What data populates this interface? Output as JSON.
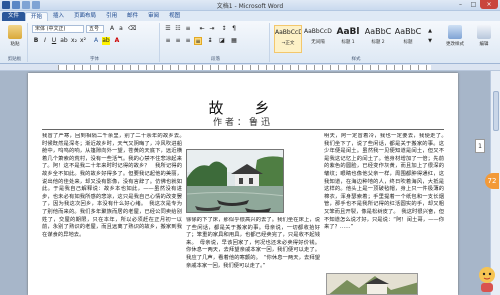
{
  "window": {
    "title": "文档1 - Microsoft Word",
    "minimize": "–",
    "maximize": "□",
    "close": "×"
  },
  "tabs": [
    "文件",
    "开始",
    "插入",
    "页面布局",
    "引用",
    "邮件",
    "审阅",
    "视图"
  ],
  "ribbon": {
    "font_name": "宋体 (中文正)",
    "font_size": "五号",
    "groups": {
      "clipboard": "剪贴板",
      "font": "字体",
      "paragraph": "段落",
      "styles": "样式",
      "editing": "编辑"
    },
    "paste_label": "粘贴",
    "styles": [
      {
        "sample": "AaBbCcDd",
        "name": "→正文",
        "selected": true
      },
      {
        "sample": "AaBbCcDd",
        "name": "无间隔",
        "selected": false
      },
      {
        "sample": "AaBl",
        "name": "标题 1",
        "selected": false
      },
      {
        "sample": "AaBbC",
        "name": "标题 2",
        "selected": false
      },
      {
        "sample": "AaBbC",
        "name": "标题",
        "selected": false
      }
    ],
    "change_styles_label": "更改样式",
    "edit_label": "编辑"
  },
  "document": {
    "title": "故　乡",
    "author": "作者：鲁迅",
    "col1": "我冒了严寒，回到相隔二千余里，别了二十余年的故乡去。　时候既然是深冬；渐近故乡时，天气又阴晦了，冷风吹进船舱中，呜呜的响，从篷隙向外一望，苍黄的天底下，远近横着几个萧索的荒村，没有一些活气。我的心禁不住悲凉起来了。阿！这不是我二十年来时时记得的故乡？　我所记得的故乡全不如此。我的故乡好得多了。但要我记起他的美丽，说出他的佳处来，却又没有影像，没有言辞了。仿佛也就如此。于是我自己解释说：故乡本也如此，——虽然没有进步，也未必有如我所感的悲凉，这只是我自己心情的改变罢了，因为我这次回乡，本没有什么好心绪。　我这次是专为了别他而来的。我们多年聚族而居的老屋，已经公同卖给别姓了，交屋的期限，只在本年，所以必须赶在正月初一以前，永别了熟识的老屋，而且远离了熟识的故乡，搬家到我在谋食的异地去。",
    "col2": "徐徐的下了床，那似乎很高兴的去了。我们坐在床上，说了些闲话，都是关于搬家的事。母亲说，一切都收拾好了；笨重的家具和用具，也都已经卖完了，只是收不起钱来。　母亲说，早该回家了，何况也还未必卖得好价钱。你休息一两天，去拜望亲戚本家一回，我们便可以走了。我应了几声，看着他的寒颤的。　“你休息一两天，去拜望亲戚本家一回，我们便可以走了。”",
    "col3": "明天，阿一定冒着冷，我也一定要去，我便走了。　我们坐下了，说了些闲话，都是关于搬家的事。这少年便是闰土。虽然我一见便知道是闰土，但又不是我这记忆上的闰土了。他身材增加了一倍；先前的紫色的圆脸，已经变作灰黄，而且加上了很深的皱纹；眼睛也像他父亲一样，周围都肿得通红，这我知道，在海边种地的人，终日吹着海风，大抵是这样的。他头上是一顶破毡帽，身上只一件极薄的棉衣，浑身瑟索着；手里提着一个纸包和一支长烟管，那手也不是我所记得的红活圆实的手，却又粗又笨而且开裂，像是松树皮了。　我这时很兴奋，但不知道怎么说才好，只是说：“阿！闰土哥，——你来了？……”",
    "page_number": "1",
    "badge": "72"
  }
}
